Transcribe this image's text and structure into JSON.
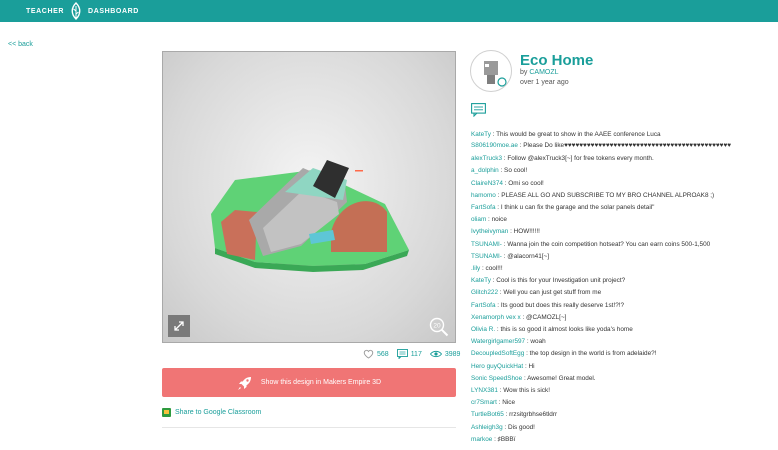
{
  "topbar": {
    "left": "TEACHER",
    "right": "DASHBOARD"
  },
  "back_link": "<< back",
  "design": {
    "title": "Eco Home",
    "by_label": "by",
    "author": "CAMOZL",
    "time_ago": "over 1 year ago",
    "view_mode": "20"
  },
  "stats": {
    "likes": "568",
    "comments": "117",
    "views": "3989"
  },
  "cta_label": "Show this design in Makers Empire 3D",
  "share_label": "Share to Google Classroom",
  "colors": {
    "accent": "#1a9e9a",
    "cta": "#f07575"
  },
  "comments": [
    {
      "name": "KateTy",
      "text": ": This would be great to show in the AAEE conference Luca"
    },
    {
      "name": "S806190moe.ae",
      "text": ": Please Do like♥♥♥♥♥♥♥♥♥♥♥♥♥♥♥♥♥♥♥♥♥♥♥♥♥♥♥♥♥♥♥♥♥♥♥♥♥♥♥♥♥♥♥♥",
      "wrap": true
    },
    {
      "name": "alexTruck3",
      "text": ": Follow @alexTruck3[~] for free tokens every month."
    },
    {
      "name": "a_dolphin",
      "text": ": So cool!"
    },
    {
      "name": "ClaireN374",
      "text": ": Omi so cool!"
    },
    {
      "name": "hamomo",
      "text": ": PLEASE ALL GO AND SUBSCRIBE TO MY BRO CHANNEL ALPROAK8 ;)"
    },
    {
      "name": "FartSofa",
      "text": ": I think u can fix the garage and the solar panels detail\""
    },
    {
      "name": "oliam",
      "text": ": noice"
    },
    {
      "name": "Ivytheivyman",
      "text": ": HOW!!!!!!"
    },
    {
      "name": "TSUNAMI-",
      "text": ": Wanna join the coin competition hotseat? You can earn coins 500-1,500"
    },
    {
      "name": "TSUNAMI-",
      "text": ": @alacorn41[~]"
    },
    {
      "name": ".lily",
      "text": ": cool!!!"
    },
    {
      "name": "KateTy",
      "text": ": Cool is this for your Investigation unit project?"
    },
    {
      "name": "Glitch222",
      "text": ": Well you can just get stuff from me"
    },
    {
      "name": "FartSofa",
      "text": ": Its good but does this really deserve 1st!?!?"
    },
    {
      "name": "Xenamorph vex x",
      "text": ": @CAMOZL[~]"
    },
    {
      "name": "Olivia R.",
      "text": ": this is so good it almost looks like yoda's home"
    },
    {
      "name": "Watergirlgamer597",
      "text": ": woah"
    },
    {
      "name": "DecoupledSoftEgg",
      "text": ": the top design in the world is from adelaide?!"
    },
    {
      "name": "Hero guyQuickHat",
      "text": ": Hi"
    },
    {
      "name": "Sonic SpeedShoe",
      "text": ": Awesome! Great model."
    },
    {
      "name": "LYNX381",
      "text": ": Wow this is sick!"
    },
    {
      "name": "cr7Smart",
      "text": ": Nice"
    },
    {
      "name": "TurtleBot65",
      "text": ": rrzsitgrbhse6tldrr"
    },
    {
      "name": "Ashleigh3g",
      "text": ": Dis good!"
    },
    {
      "name": "markoe",
      "text": ": ♯BBBï"
    }
  ]
}
